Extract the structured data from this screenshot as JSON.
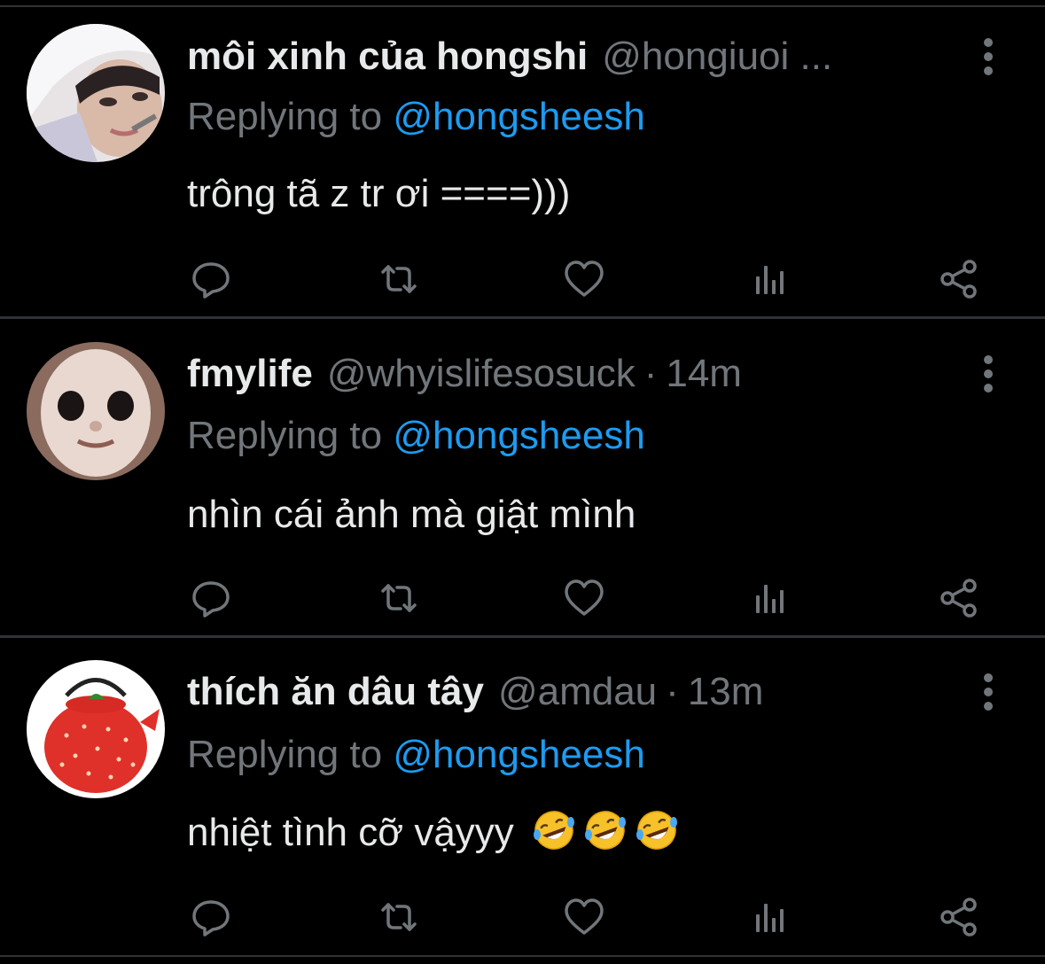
{
  "tweets": [
    {
      "name": "môi xinh của hongshi",
      "handle": "@hongiuoi ...",
      "dot": "",
      "time": "",
      "replying_prefix": "Replying to ",
      "replying_to": "@hongsheesh",
      "text": "trông tã z tr ơi ====)))",
      "emoji": []
    },
    {
      "name": "fmylife",
      "handle": "@whyislifesosuck",
      "dot": "·",
      "time": "14m",
      "replying_prefix": "Replying to ",
      "replying_to": "@hongsheesh",
      "text": "nhìn cái ảnh mà giật mình",
      "emoji": []
    },
    {
      "name": "thích ăn dâu tây",
      "handle": "@amdau",
      "dot": "·",
      "time": "13m",
      "replying_prefix": "Replying to ",
      "replying_to": "@hongsheesh",
      "text": "nhiệt tình cỡ vậyyy",
      "emoji": [
        "rolling-on-floor-laughing",
        "rolling-on-floor-laughing",
        "rolling-on-floor-laughing"
      ]
    }
  ],
  "icons": {
    "reply": "reply-icon",
    "retweet": "retweet-icon",
    "like": "heart-icon",
    "views": "views-icon",
    "share": "share-icon",
    "more": "more-vertical-icon"
  },
  "colors": {
    "background": "#000000",
    "text": "#e7e9ea",
    "muted": "#71767b",
    "link": "#1d9bf0",
    "divider": "#2f3336"
  }
}
